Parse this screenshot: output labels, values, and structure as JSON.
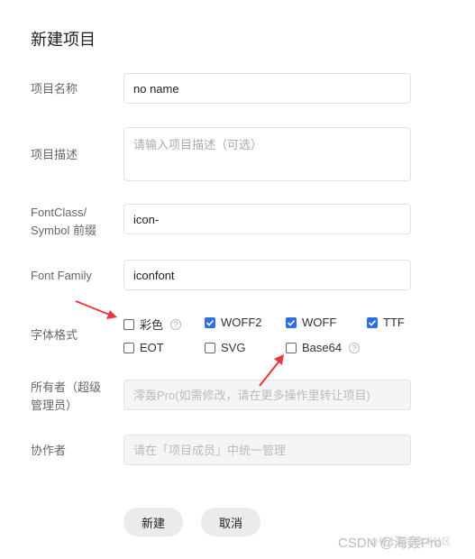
{
  "page": {
    "title": "新建项目"
  },
  "form": {
    "name": {
      "label": "项目名称",
      "value": "no name"
    },
    "description": {
      "label": "项目描述",
      "placeholder": "请输入项目描述（可选）"
    },
    "font_class": {
      "label_line1": "FontClass/",
      "label_line2": "Symbol 前缀",
      "value": "icon-"
    },
    "font_family": {
      "label": "Font Family",
      "value": "iconfont"
    },
    "font_format": {
      "label": "字体格式",
      "options": [
        {
          "label": "彩色",
          "checked": false
        },
        {
          "label": "WOFF2",
          "checked": true
        },
        {
          "label": "WOFF",
          "checked": true
        },
        {
          "label": "TTF",
          "checked": true
        },
        {
          "label": "EOT",
          "checked": false
        },
        {
          "label": "SVG",
          "checked": false
        },
        {
          "label": "Base64",
          "checked": false
        }
      ],
      "help_glyph": "?"
    },
    "owner": {
      "label_line1": "所有者（超级",
      "label_line2": "管理员）",
      "placeholder": "澪轰Pro(如需修改，请在更多操作里转让项目)"
    },
    "collaborators": {
      "label": "协作者",
      "placeholder": "请在「项目成员」中统一管理"
    }
  },
  "buttons": {
    "create": "新建",
    "cancel": "取消"
  },
  "annotation": {
    "arrow_color": "#e8383d"
  },
  "accent_color": "#2f6ee5",
  "watermark": {
    "text": "CSDN @海轰Pro",
    "small": "@稀土掘金技术社区"
  }
}
